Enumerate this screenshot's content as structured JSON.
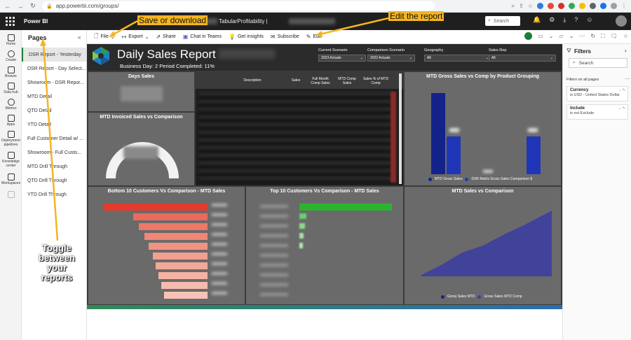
{
  "browser": {
    "url": "app.powerbi.com/groups/"
  },
  "header": {
    "app_name": "Power BI",
    "workspace_title": "TabularProfitability |",
    "search_placeholder": "Search"
  },
  "leftnav": {
    "items": [
      "Home",
      "Create",
      "Browse",
      "Data hub",
      "Metrics",
      "Apps",
      "Deployment pipelines",
      "Knowledge center",
      "Workspaces"
    ]
  },
  "pages": {
    "title": "Pages",
    "items": [
      "DSR Report - Yesterday",
      "DSR Report - Day Select...",
      "Showroom - DSR Repor...",
      "MTD Detail",
      "QTD Detail",
      "YTD Detail",
      "Full Customer Detail w/ ...",
      "Showroom - Full Custo...",
      "MTD Drill Through",
      "QTD Drill Through",
      "YTD Drill Through"
    ]
  },
  "toolbar": {
    "file": "File",
    "export": "Export",
    "share": "Share",
    "chat": "Chat in Teams",
    "insights": "Get insights",
    "subscribe": "Subscribe",
    "edit": "Edit"
  },
  "report": {
    "title": "Daily Sales Report",
    "subtitle": "Business Day: 2    Period Completed: 11%",
    "slicers": [
      {
        "label": "Current Scenario",
        "value": "2023 Actuals"
      },
      {
        "label": "Comparison Scenario",
        "value": "2022 Actuals"
      },
      {
        "label": "Geography",
        "value": "All"
      },
      {
        "label": "Sales Rep",
        "value": "All"
      }
    ],
    "tiles": {
      "days_sales": "Days Sales",
      "mtd_invoiced": "MTD Invoiced Sales vs Comparison",
      "table_cols": [
        "Description",
        "Sales",
        "Full Month Comp Sales",
        "MTD Comp Sales",
        "Sales % of MTD Comp"
      ],
      "gross_by_group": "MTD Gross Sales vs Comp by Product Grouping",
      "gross_by_group_legend": [
        "MTD Gross Sales",
        "DSR Matrix Gross Sales Comparison $"
      ],
      "bottom10": "Bottom 10 Customers Vs Comparison - MTD Sales",
      "top10": "Top 10 Customers Vs Comparison - MTD Sales",
      "mtd_sales": "MTD Sales vs Comparison",
      "mtd_sales_legend": [
        "Gross Sales MTD",
        "Gross Sales MTD Comp"
      ]
    }
  },
  "filters": {
    "title": "Filters",
    "search": "Search",
    "section": "Filters on all pages",
    "cards": [
      {
        "name": "Currency",
        "value": "is USD - United States Dollar"
      },
      {
        "name": "Include",
        "value": "is not Exclude"
      }
    ]
  },
  "annotations": {
    "save": "Save or download",
    "edit": "Edit the report",
    "toggle": "Toggle between your reports"
  },
  "colors": {
    "accent_green": "#1a7f37",
    "bar_dark_blue": "#14238a",
    "bar_blue": "#2036b8",
    "area_purple": "#3d3fa0",
    "bottom_red": "#e34b3c",
    "top_green": "#2bb330",
    "annotation": "#f4b521"
  }
}
